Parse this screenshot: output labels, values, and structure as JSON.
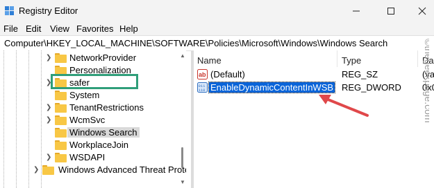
{
  "window": {
    "title": "Registry Editor"
  },
  "menu": [
    "File",
    "Edit",
    "View",
    "Favorites",
    "Help"
  ],
  "address": "Computer\\HKEY_LOCAL_MACHINE\\SOFTWARE\\Policies\\Microsoft\\Windows\\Windows Search",
  "tree": {
    "items": [
      {
        "label": "NetworkProvider",
        "expandable": true
      },
      {
        "label": "Personalization",
        "expandable": false
      },
      {
        "label": "safer",
        "expandable": true
      },
      {
        "label": "System",
        "expandable": false
      },
      {
        "label": "TenantRestrictions",
        "expandable": true
      },
      {
        "label": "WcmSvc",
        "expandable": true
      },
      {
        "label": "Windows Search",
        "expandable": false,
        "selected": true
      },
      {
        "label": "WorkplaceJoin",
        "expandable": false
      },
      {
        "label": "WSDAPI",
        "expandable": true
      },
      {
        "label": "Windows Advanced Threat Prote",
        "expandable": true
      }
    ]
  },
  "values": {
    "columns": {
      "name": "Name",
      "type": "Type",
      "data": "Da"
    },
    "rows": [
      {
        "icon": "string-value-icon",
        "name": "(Default)",
        "type": "REG_SZ",
        "data": "(va"
      },
      {
        "icon": "binary-value-icon",
        "name": "EnableDynamicContentInWSB",
        "type": "REG_DWORD",
        "data": "0x0",
        "selected": true
      }
    ]
  },
  "watermark": "©thegeekpage.com",
  "colors": {
    "highlight_box": "#2f9e79",
    "arrow": "#e0484a",
    "selection": "#0a64d8"
  }
}
